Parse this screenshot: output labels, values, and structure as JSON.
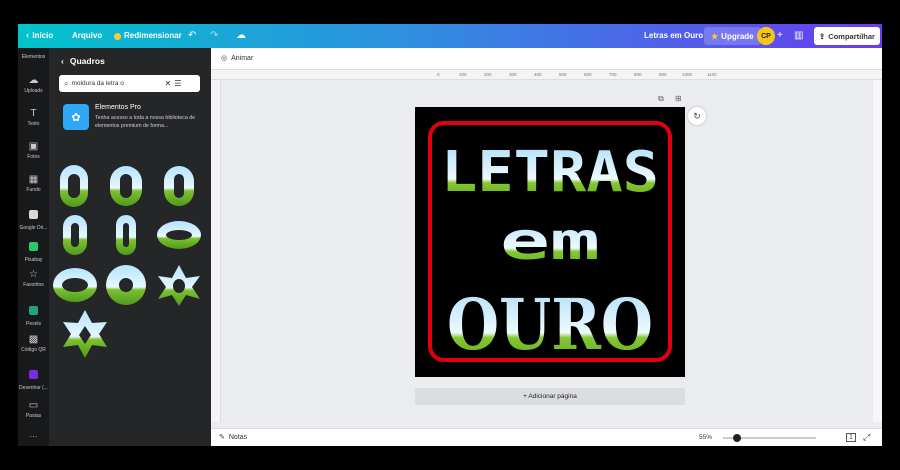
{
  "topbar": {
    "home_label": "Início",
    "file_label": "Arquivo",
    "resize_label": "Redimensionar",
    "design_title": "Letras em Ouro",
    "upgrade_label": "Upgrade",
    "avatar_initials": "CP",
    "share_label": "Compartilhar"
  },
  "rail": {
    "items": [
      {
        "label": "Elementos",
        "icon": "elements-icon"
      },
      {
        "label": "Uploads",
        "icon": "upload-icon"
      },
      {
        "label": "Texto",
        "icon": "text-icon"
      },
      {
        "label": "Fotos",
        "icon": "photos-icon"
      },
      {
        "label": "Fundo",
        "icon": "background-icon"
      },
      {
        "label": "Google Dri...",
        "icon": "google-drive-icon"
      },
      {
        "label": "Pixabay",
        "icon": "pixabay-icon"
      },
      {
        "label": "Favoritos",
        "icon": "star-icon"
      },
      {
        "label": "Pexels",
        "icon": "pexels-icon"
      },
      {
        "label": "Código QR",
        "icon": "qr-code-icon"
      },
      {
        "label": "Desenhar (...",
        "icon": "draw-icon"
      },
      {
        "label": "Pastas",
        "icon": "folder-icon"
      }
    ]
  },
  "panel": {
    "title": "Quadros",
    "search_value": "moldura da letra o",
    "pro_title": "Elementos Pro",
    "pro_description": "Tenha acesso a toda a nossa biblioteca de elementos premium de forma..."
  },
  "canvas": {
    "animate_label": "Animar",
    "add_page_label": "+ Adicionar página",
    "ruler_ticks": [
      "0",
      "100",
      "200",
      "300",
      "400",
      "500",
      "600",
      "700",
      "800",
      "900",
      "1000",
      "1100"
    ],
    "design_lines": [
      "LETRAS",
      "em",
      "OURO"
    ]
  },
  "bottombar": {
    "notes_label": "Notas",
    "zoom_label": "55%",
    "zoom_value": 0.55,
    "page_count": "1"
  },
  "colors": {
    "frame_red": "#e0000f",
    "letter_sky": "#c9ecff",
    "letter_grass": "#7cc12f",
    "accent_purple": "#7d2ae8"
  }
}
